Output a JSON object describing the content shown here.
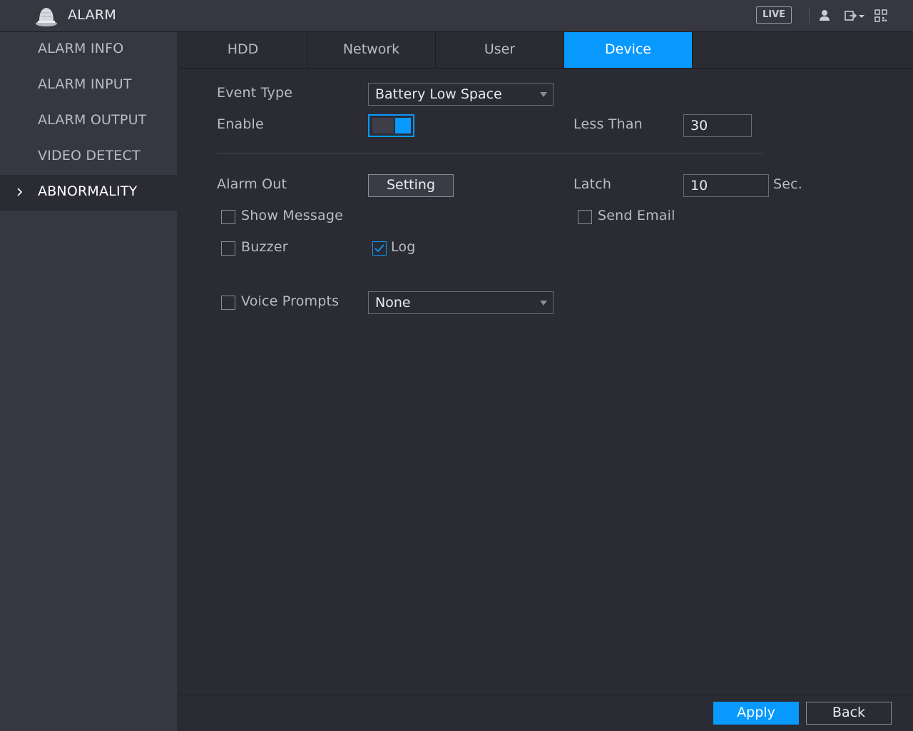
{
  "header": {
    "title": "ALARM",
    "live_label": "LIVE",
    "icons": [
      "alarm-bell-icon",
      "user-icon",
      "logout-icon",
      "chevron-down-icon",
      "qr-code-icon"
    ]
  },
  "sidebar": {
    "items": [
      {
        "label": "ALARM INFO",
        "active": false
      },
      {
        "label": "ALARM INPUT",
        "active": false
      },
      {
        "label": "ALARM OUTPUT",
        "active": false
      },
      {
        "label": "VIDEO DETECT",
        "active": false
      },
      {
        "label": "ABNORMALITY",
        "active": true
      }
    ]
  },
  "tabs": [
    {
      "label": "HDD",
      "active": false
    },
    {
      "label": "Network",
      "active": false
    },
    {
      "label": "User",
      "active": false
    },
    {
      "label": "Device",
      "active": true
    }
  ],
  "form": {
    "event_type_label": "Event Type",
    "event_type_value": "Battery Low Space",
    "enable_label": "Enable",
    "enable_on": true,
    "less_than_label": "Less Than",
    "less_than_value": "30",
    "alarm_out_label": "Alarm Out",
    "setting_label": "Setting",
    "latch_label": "Latch",
    "latch_value": "10",
    "latch_unit": "Sec.",
    "show_message_label": "Show Message",
    "show_message_checked": false,
    "send_email_label": "Send Email",
    "send_email_checked": false,
    "buzzer_label": "Buzzer",
    "buzzer_checked": false,
    "log_label": "Log",
    "log_checked": true,
    "voice_prompts_label": "Voice Prompts",
    "voice_prompts_checked": false,
    "voice_prompts_value": "None"
  },
  "footer": {
    "apply_label": "Apply",
    "back_label": "Back"
  },
  "colors": {
    "accent": "#0899ff",
    "background": "#2a2b33",
    "panel": "#363741"
  }
}
